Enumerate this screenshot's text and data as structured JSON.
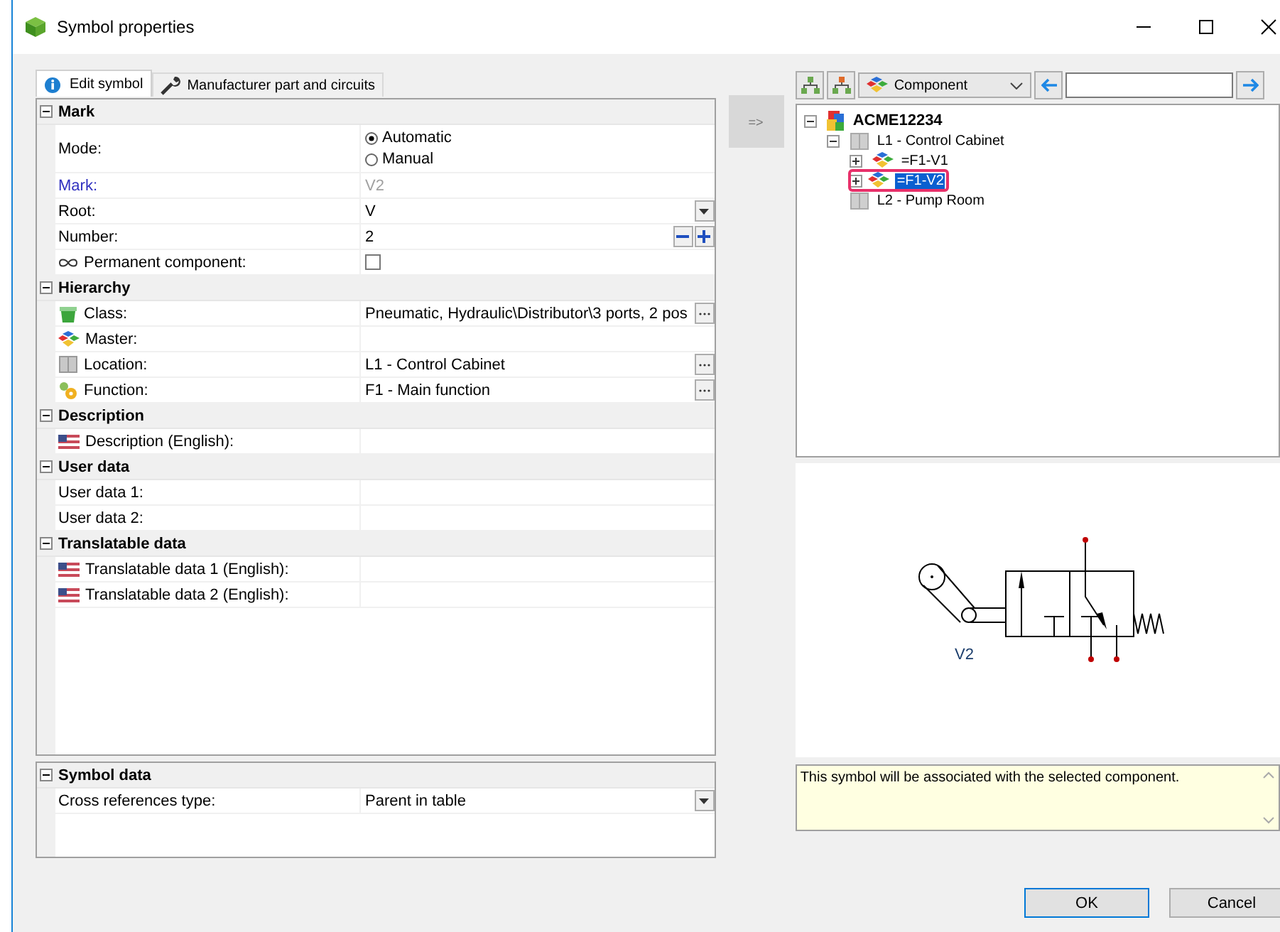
{
  "window": {
    "title": "Symbol properties"
  },
  "tabs": [
    {
      "label": "Edit symbol",
      "selected": true
    },
    {
      "label": "Manufacturer part and circuits",
      "selected": false
    }
  ],
  "sections": [
    {
      "title": "Mark",
      "expanded": true,
      "rows": [
        {
          "kind": "radio",
          "label": "Mode:",
          "options": [
            {
              "label": "Automatic",
              "selected": true
            },
            {
              "label": "Manual",
              "selected": false
            }
          ]
        },
        {
          "kind": "text",
          "label": "Mark:",
          "value": "V2",
          "disabled": true
        },
        {
          "kind": "dropdown",
          "label": "Root:",
          "value": "V"
        },
        {
          "kind": "spinner",
          "label": "Number:",
          "value": "2"
        },
        {
          "kind": "checkbox",
          "label": "Permanent component:",
          "checked": false
        }
      ]
    },
    {
      "title": "Hierarchy",
      "expanded": true,
      "rows": [
        {
          "kind": "browse",
          "label": "Class:",
          "value": "Pneumatic, Hydraulic\\Distributor\\3 ports, 2 pos"
        },
        {
          "kind": "text",
          "label": "Master:"
        },
        {
          "kind": "browse",
          "label": "Location:",
          "value": "L1 - Control Cabinet"
        },
        {
          "kind": "browse",
          "label": "Function:",
          "value": "F1 - Main function"
        }
      ]
    },
    {
      "title": "Description",
      "expanded": true,
      "rows": [
        {
          "kind": "text",
          "label": "Description (English):"
        }
      ]
    },
    {
      "title": "User data",
      "expanded": true,
      "rows": [
        {
          "kind": "text",
          "label": "User data 1:"
        },
        {
          "kind": "text",
          "label": "User data 2:"
        }
      ]
    },
    {
      "title": "Translatable data",
      "expanded": true,
      "rows": [
        {
          "kind": "text",
          "label": "Translatable data 1 (English):"
        },
        {
          "kind": "text",
          "label": "Translatable data 2 (English):"
        }
      ]
    }
  ],
  "symbol_data": {
    "title": "Symbol data",
    "expanded": true,
    "rows": [
      {
        "kind": "dropdown",
        "label": "Cross references type:",
        "value": "Parent in table"
      }
    ]
  },
  "assign_button": {
    "label": "=>",
    "disabled": true
  },
  "toolbar": {
    "filter": {
      "value": "Component"
    }
  },
  "tree": [
    {
      "label": "ACME12234",
      "expanded": true,
      "selected": false,
      "children": [
        {
          "label": "L1 - Control Cabinet",
          "expanded": true,
          "selected": false,
          "children": [
            {
              "label": "=F1-V1",
              "expanded": false,
              "selected": false
            },
            {
              "label": "=F1-V2",
              "expanded": false,
              "selected": true,
              "highlighted": true
            }
          ]
        },
        {
          "label": "L2 - Pump Room",
          "selected": false
        }
      ]
    }
  ],
  "preview": {
    "symbol_label": "V2"
  },
  "info": "This symbol will be associated with the selected component.",
  "buttons": [
    {
      "label": "OK",
      "default": true
    },
    {
      "label": "Cancel",
      "default": false
    }
  ]
}
